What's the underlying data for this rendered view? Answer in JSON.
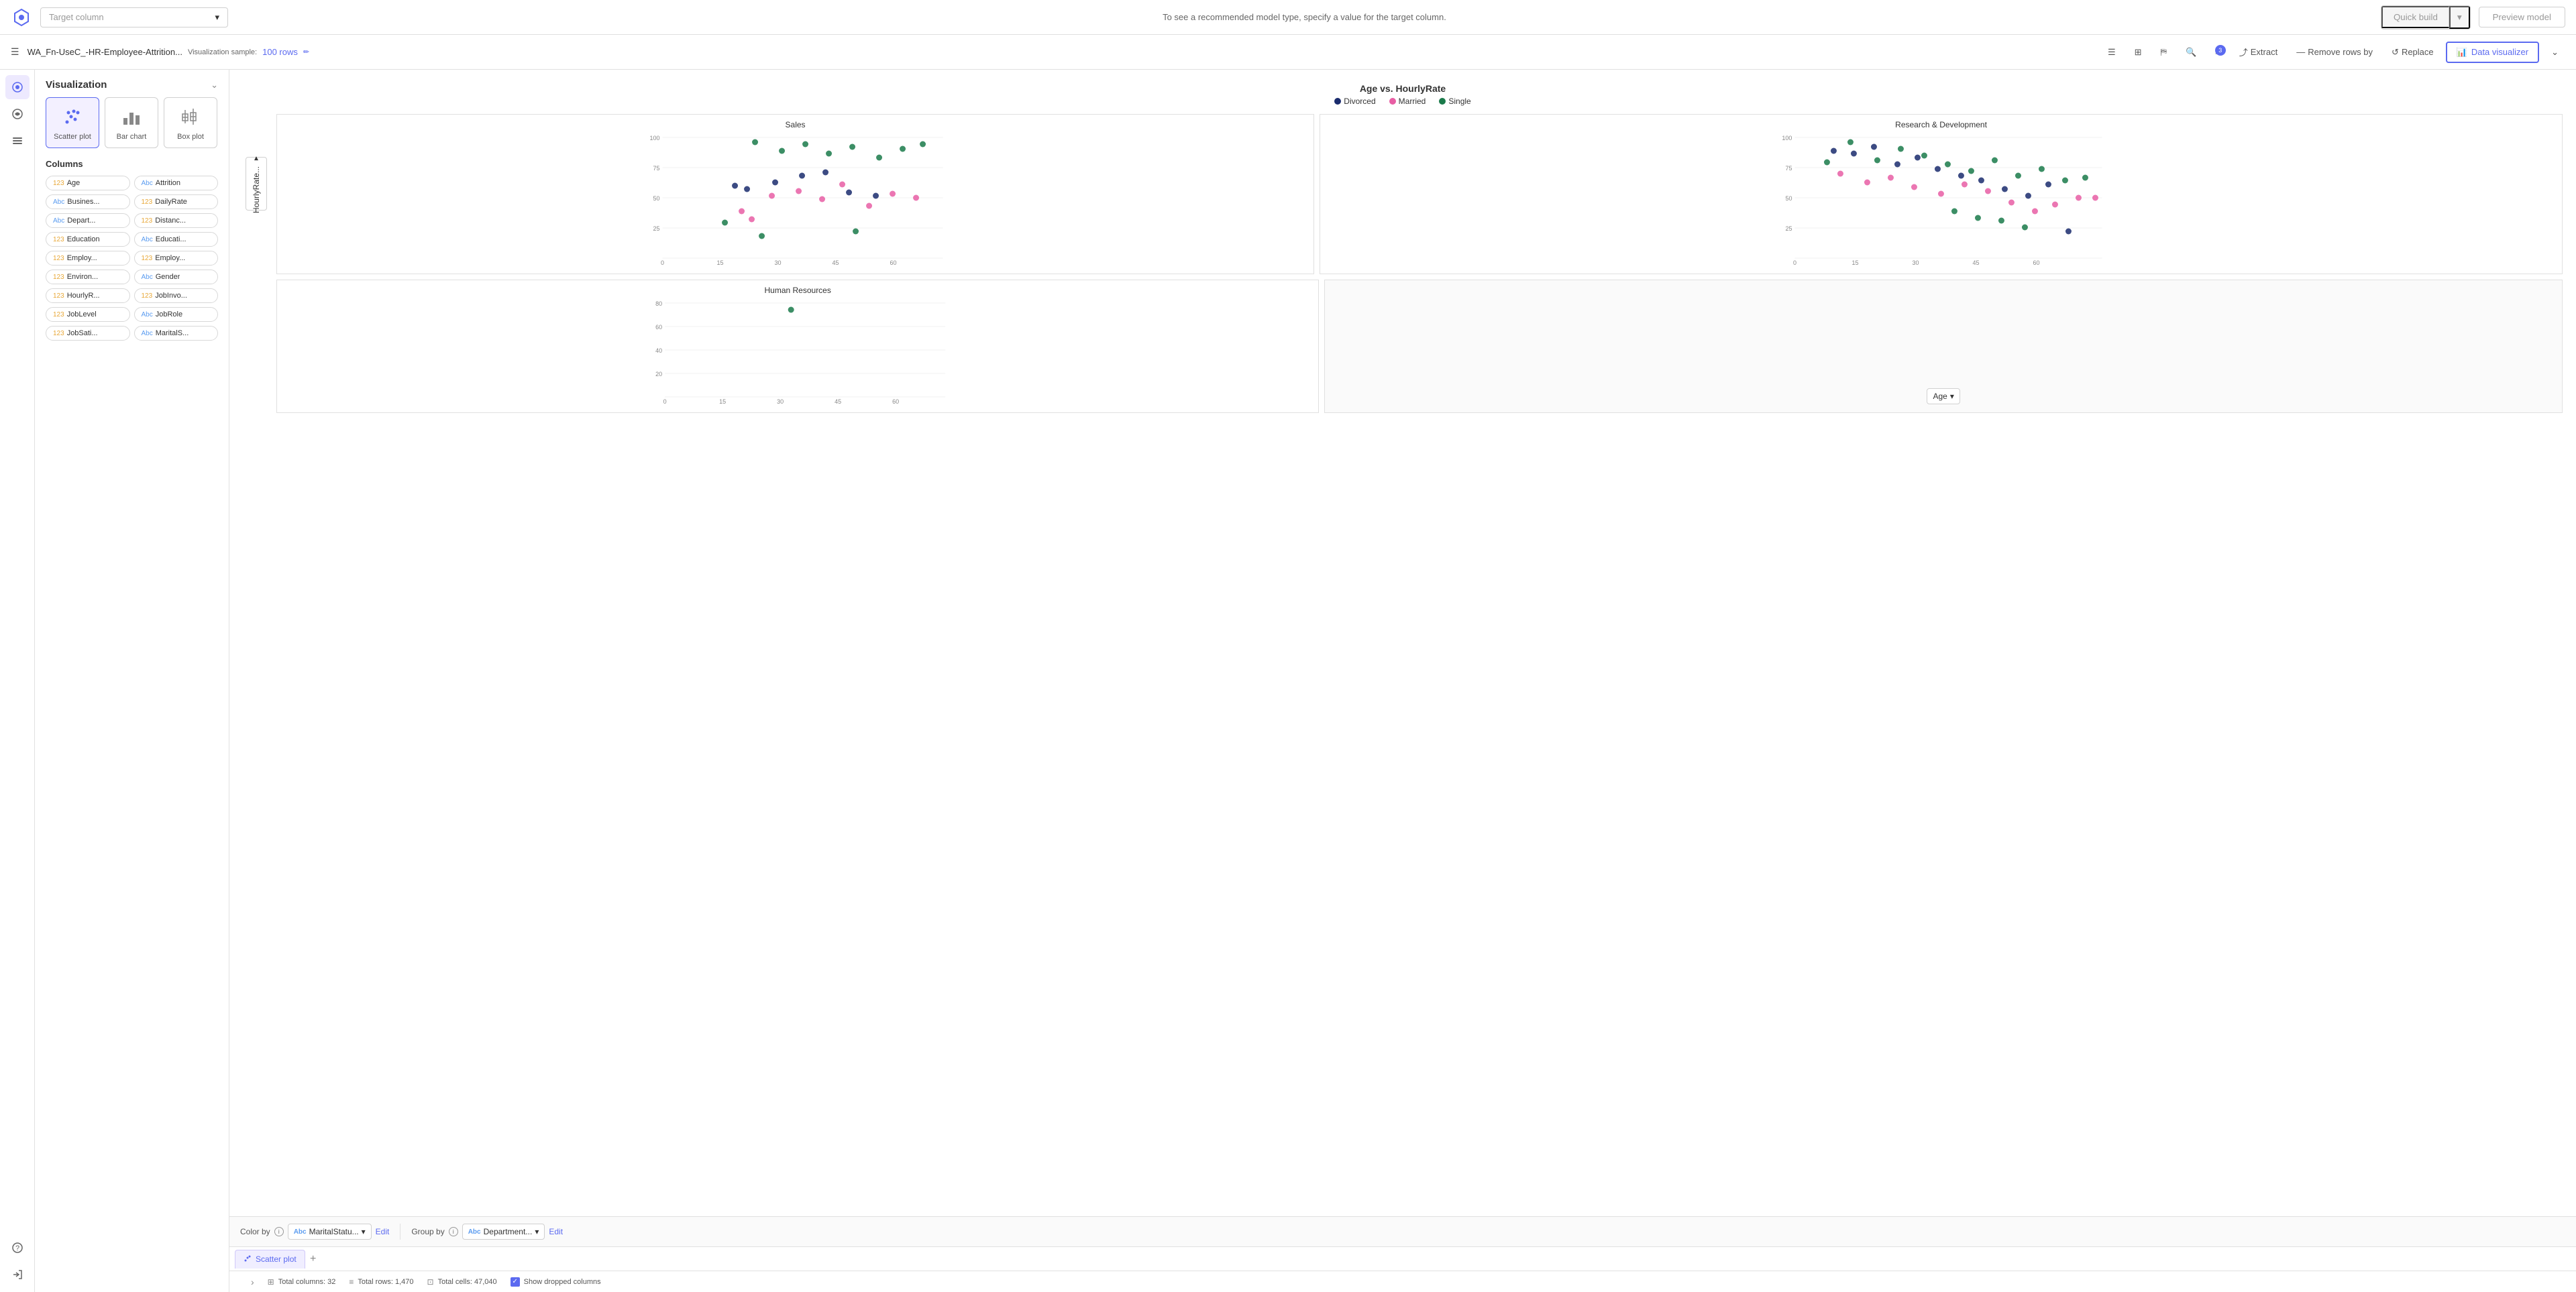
{
  "topBar": {
    "targetColumnPlaceholder": "Target column",
    "hintText": "To see a recommended model type, specify a value for the target column.",
    "quickBuildLabel": "Quick build",
    "previewModelLabel": "Preview model"
  },
  "secondBar": {
    "fileName": "WA_Fn-UseC_-HR-Employee-Attrition...",
    "visualizationSample": "Visualization sample:",
    "sampleRows": "100 rows",
    "extractLabel": "Extract",
    "removeRowsLabel": "Remove rows by",
    "replaceLabel": "Replace",
    "dataVisualizerLabel": "Data visualizer",
    "filterBadgeCount": "3"
  },
  "sidebar": {
    "title": "Visualization",
    "chartTypes": [
      {
        "id": "scatter",
        "label": "Scatter plot",
        "active": true
      },
      {
        "id": "bar",
        "label": "Bar chart",
        "active": false
      },
      {
        "id": "box",
        "label": "Box plot",
        "active": false
      }
    ],
    "columnsTitle": "Columns",
    "columns": [
      {
        "type": "123",
        "name": "Age"
      },
      {
        "type": "Abc",
        "name": "Attrition"
      },
      {
        "type": "Abc",
        "name": "Busines..."
      },
      {
        "type": "123",
        "name": "DailyRate"
      },
      {
        "type": "Abc",
        "name": "Depart..."
      },
      {
        "type": "123",
        "name": "Distanc..."
      },
      {
        "type": "123",
        "name": "Education"
      },
      {
        "type": "Abc",
        "name": "Educati..."
      },
      {
        "type": "123",
        "name": "Employ..."
      },
      {
        "type": "123",
        "name": "Employ..."
      },
      {
        "type": "123",
        "name": "Environ..."
      },
      {
        "type": "Abc",
        "name": "Gender"
      },
      {
        "type": "123",
        "name": "HourlyR..."
      },
      {
        "type": "123",
        "name": "JobInvo..."
      },
      {
        "type": "123",
        "name": "JobLevel"
      },
      {
        "type": "Abc",
        "name": "JobRole"
      },
      {
        "type": "123",
        "name": "JobSati..."
      },
      {
        "type": "Abc",
        "name": "MaritalS..."
      }
    ]
  },
  "chart": {
    "title": "Age vs. HourlyRate",
    "legend": [
      {
        "label": "Divorced",
        "color": "#1a2b6d"
      },
      {
        "label": "Married",
        "color": "#e85ea4"
      },
      {
        "label": "Single",
        "color": "#1a7a4a"
      }
    ],
    "panels": [
      {
        "title": "Sales",
        "xMin": 0,
        "xMax": 60,
        "yMin": 0,
        "yMax": 100
      },
      {
        "title": "Research & Development",
        "xMin": 0,
        "xMax": 60,
        "yMin": 0,
        "yMax": 100
      },
      {
        "title": "Human Resources",
        "xMin": 0,
        "xMax": 60,
        "yMin": 0,
        "yMax": 80
      }
    ],
    "yAxisLabel": "HourlyRate...",
    "xAxisLabel": "Age",
    "groupByLabel": "Department...",
    "colorByLabel": "MaritalStatu..."
  },
  "bottomControls": {
    "colorByLabel": "Color by",
    "colorByValue": "MaritalStatu...",
    "colorByEdit": "Edit",
    "groupByLabel": "Group by",
    "groupByValue": "Department...",
    "groupByEdit": "Edit"
  },
  "tabs": [
    {
      "label": "Scatter plot",
      "active": true
    }
  ],
  "addTabLabel": "+",
  "statusBar": {
    "totalColumns": "Total columns: 32",
    "totalRows": "Total rows: 1,470",
    "totalCells": "Total cells: 47,040",
    "showDroppedLabel": "Show dropped columns"
  }
}
